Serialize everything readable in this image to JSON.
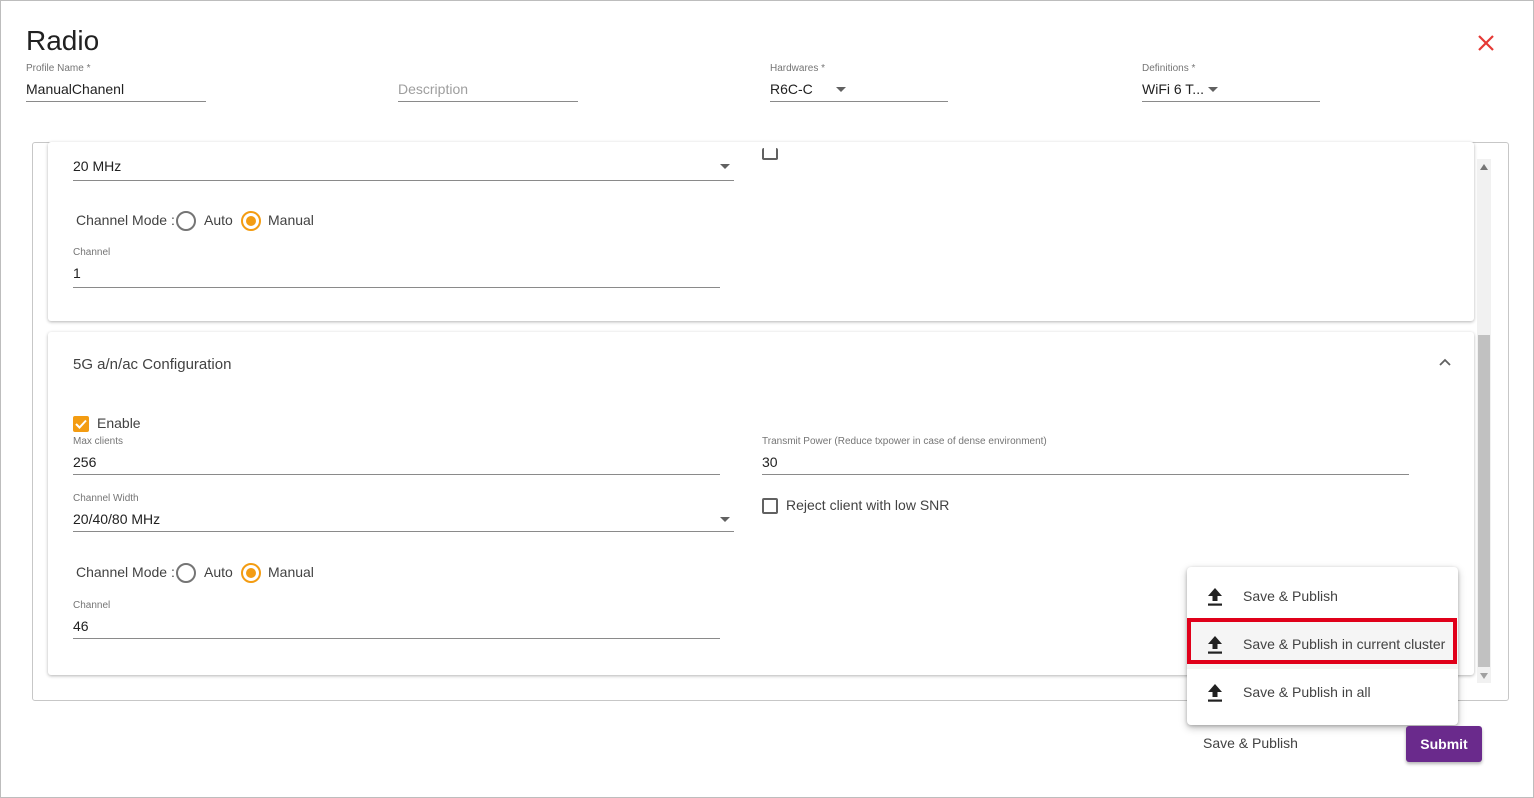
{
  "dialog": {
    "title": "Radio"
  },
  "header": {
    "profile_name": {
      "label": "Profile Name *",
      "value": "ManualChanenl"
    },
    "description": {
      "placeholder": "Description"
    },
    "hardwares": {
      "label": "Hardwares *",
      "value": "R6C-C"
    },
    "definitions": {
      "label": "Definitions *",
      "value": "WiFi 6 T..."
    }
  },
  "section_24g": {
    "channel_width": {
      "value": "20 MHz"
    },
    "channel_mode": {
      "label": "Channel Mode :",
      "options": [
        "Auto",
        "Manual"
      ],
      "selected": "Manual"
    },
    "channel": {
      "label": "Channel",
      "value": "1"
    }
  },
  "section_5g": {
    "title": "5G a/n/ac Configuration",
    "enable": {
      "label": "Enable",
      "checked": true
    },
    "max_clients": {
      "label": "Max clients",
      "value": "256"
    },
    "transmit_power": {
      "label": "Transmit Power (Reduce txpower in case of dense environment)",
      "value": "30"
    },
    "channel_width": {
      "label": "Channel Width",
      "value": "20/40/80 MHz"
    },
    "reject_low_snr": {
      "label": "Reject client with low SNR",
      "checked": false
    },
    "channel_mode": {
      "label": "Channel Mode :",
      "options": [
        "Auto",
        "Manual"
      ],
      "selected": "Manual"
    },
    "channel": {
      "label": "Channel",
      "value": "46"
    }
  },
  "publish_menu": {
    "items": [
      "Save & Publish",
      "Save & Publish in current cluster",
      "Save & Publish in all"
    ],
    "highlighted": "Save & Publish in current cluster"
  },
  "footer": {
    "save_publish_label": "Save & Publish",
    "submit_label": "Submit"
  },
  "colors": {
    "accent": "#f39c12",
    "submit": "#6a2a8c",
    "close": "#e53935",
    "highlight": "#e0001a"
  }
}
